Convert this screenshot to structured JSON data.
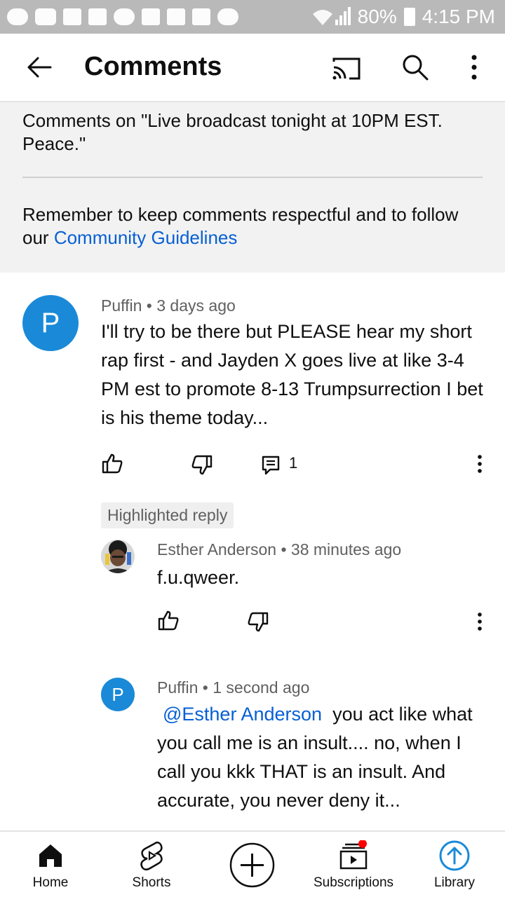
{
  "status_bar": {
    "battery": "80%",
    "time": "4:15 PM"
  },
  "app_bar": {
    "title": "Comments"
  },
  "header": {
    "comments_on": "Comments on \"Live broadcast tonight at 10PM EST.  Peace.\"",
    "reminder_prefix": "Remember to keep comments respectful and to follow our ",
    "reminder_link": "Community Guidelines"
  },
  "comment": {
    "avatar_letter": "P",
    "author": "Puffin",
    "separator": "•",
    "time": "3 days ago",
    "text": "I'll try to be there but PLEASE hear my short rap first - and Jayden X goes live at like 3-4 PM est to promote 8-13 Trumpsurrection I bet is his theme today...",
    "reply_count": "1"
  },
  "highlighted_label": "Highlighted reply",
  "replies": [
    {
      "author": "Esther Anderson",
      "separator": "•",
      "time": "38 minutes ago",
      "text": "f.u.qweer."
    },
    {
      "avatar_letter": "P",
      "author": "Puffin",
      "separator": "•",
      "time": "1 second ago",
      "mention": "@Esther Anderson",
      "text_first": "you act like what",
      "text_rest": "you call me is an insult.... no, when I call you kkk THAT is an insult. And accurate, you never deny it..."
    }
  ],
  "bottom_nav": {
    "items": [
      {
        "label": "Home",
        "icon": "home-icon"
      },
      {
        "label": "Shorts",
        "icon": "shorts-icon"
      },
      {
        "label": "",
        "icon": "create-icon"
      },
      {
        "label": "Subscriptions",
        "icon": "subscriptions-icon"
      },
      {
        "label": "Library",
        "icon": "library-icon"
      }
    ]
  },
  "colors": {
    "accent": "#065fd4",
    "avatar": "#1a8ad8",
    "notification": "#ff0000",
    "status_bar": "#b9b9b9"
  }
}
